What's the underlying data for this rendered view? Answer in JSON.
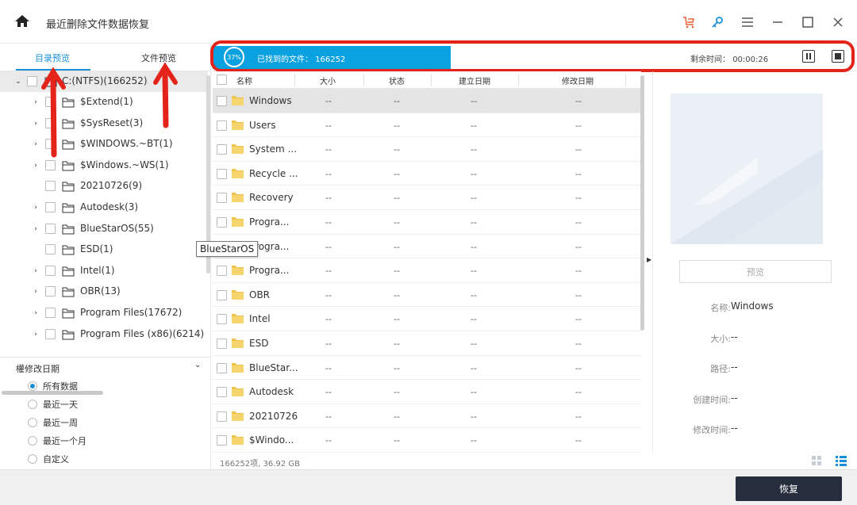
{
  "app": {
    "title": "最近删除文件数据恢复"
  },
  "left": {
    "tabs": [
      {
        "label": "目录预览"
      },
      {
        "label": "文件预览"
      }
    ],
    "tree": {
      "root": "C:(NTFS)(166252)",
      "items": [
        {
          "label": "$Extend(1)"
        },
        {
          "label": "$SysReset(3)"
        },
        {
          "label": "$WINDOWS.~BT(1)"
        },
        {
          "label": "$Windows.~WS(1)"
        },
        {
          "label": "20210726(9)"
        },
        {
          "label": "Autodesk(3)"
        },
        {
          "label": "BlueStarOS(55)"
        },
        {
          "label": "ESD(1)"
        },
        {
          "label": "Intel(1)"
        },
        {
          "label": "OBR(13)"
        },
        {
          "label": "Program Files(17672)"
        },
        {
          "label": "Program Files (x86)(6214)"
        }
      ]
    },
    "filter": {
      "title": "權修改日期",
      "options": [
        {
          "label": "所有数据"
        },
        {
          "label": "最近一天"
        },
        {
          "label": "最近一周"
        },
        {
          "label": "最近一个月"
        },
        {
          "label": "自定义"
        }
      ],
      "selected": "所有数据"
    }
  },
  "progress": {
    "percent_label": "37%",
    "percent": 37,
    "found_label": "已找到的文件：",
    "found_count": "166252",
    "remaining_label": "剩余时间：",
    "remaining_time": "00:00:26"
  },
  "table": {
    "headers": [
      "名称",
      "大小",
      "状态",
      "建立日期",
      "修改日期"
    ],
    "rows": [
      {
        "name": "Windows",
        "size": "--",
        "status": "--",
        "created": "--",
        "modified": "--"
      },
      {
        "name": "Users",
        "size": "--",
        "status": "--",
        "created": "--",
        "modified": "--"
      },
      {
        "name": "System ...",
        "size": "--",
        "status": "--",
        "created": "--",
        "modified": "--"
      },
      {
        "name": "Recycle ...",
        "size": "--",
        "status": "--",
        "created": "--",
        "modified": "--"
      },
      {
        "name": "Recovery",
        "size": "--",
        "status": "--",
        "created": "--",
        "modified": "--"
      },
      {
        "name": "Progra...",
        "size": "--",
        "status": "--",
        "created": "--",
        "modified": "--"
      },
      {
        "name": "Progra...",
        "size": "--",
        "status": "--",
        "created": "--",
        "modified": "--"
      },
      {
        "name": "Progra...",
        "size": "--",
        "status": "--",
        "created": "--",
        "modified": "--"
      },
      {
        "name": "OBR",
        "size": "--",
        "status": "--",
        "created": "--",
        "modified": "--"
      },
      {
        "name": "Intel",
        "size": "--",
        "status": "--",
        "created": "--",
        "modified": "--"
      },
      {
        "name": "ESD",
        "size": "--",
        "status": "--",
        "created": "--",
        "modified": "--"
      },
      {
        "name": "BlueStar...",
        "size": "--",
        "status": "--",
        "created": "--",
        "modified": "--"
      },
      {
        "name": "Autodesk",
        "size": "--",
        "status": "--",
        "created": "--",
        "modified": "--"
      },
      {
        "name": "20210726",
        "size": "--",
        "status": "--",
        "created": "--",
        "modified": "--"
      },
      {
        "name": "$Windo...",
        "size": "--",
        "status": "--",
        "created": "--",
        "modified": "--"
      }
    ],
    "footer": "166252项, 36.92 GB"
  },
  "tooltip": "BlueStarOS",
  "preview": {
    "button": "预览",
    "props": [
      {
        "key": "名称:",
        "value": "Windows"
      },
      {
        "key": "大小:",
        "value": "--"
      },
      {
        "key": "路径:",
        "value": "--"
      },
      {
        "key": "创建时间:",
        "value": "--"
      },
      {
        "key": "修改时间:",
        "value": "--"
      }
    ]
  },
  "bottom": {
    "recover_label": "恢复"
  },
  "colors": {
    "accent": "#1a8fd9",
    "progress": "#0aa1e0",
    "annotation": "#e4231b",
    "dark_button": "#262d3c"
  }
}
